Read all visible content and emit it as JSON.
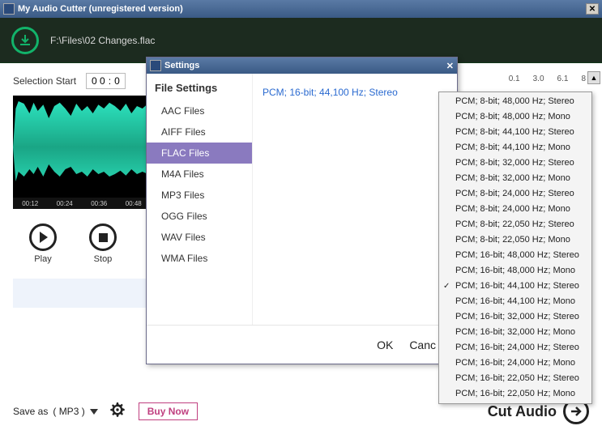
{
  "window": {
    "title": "My Audio Cutter (unregistered version)"
  },
  "file": {
    "path": "F:\\Files\\02 Changes.flac"
  },
  "selection": {
    "start_label": "Selection Start",
    "start_seg1": "0 0",
    "start_seg2": "0"
  },
  "scale": [
    "0.1",
    "3.0",
    "6.1",
    "8"
  ],
  "waveform_ticks": [
    "00:12",
    "00:24",
    "00:36",
    "00:48"
  ],
  "transport": {
    "play": "Play",
    "stop": "Stop"
  },
  "footer": {
    "save_as_prefix": "Save as",
    "save_as_fmt": "( MP3 )",
    "buy": "Buy Now",
    "cut": "Cut Audio"
  },
  "settings": {
    "title": "Settings",
    "heading": "File Settings",
    "items": [
      "AAC Files",
      "AIFF Files",
      "FLAC Files",
      "M4A Files",
      "MP3 Files",
      "OGG Files",
      "WAV Files",
      "WMA Files"
    ],
    "selected_index": 2,
    "current_format": "PCM; 16-bit; 44,100 Hz; Stereo",
    "ok": "OK",
    "cancel": "Canc"
  },
  "dropdown": {
    "options": [
      "PCM; 8-bit; 48,000 Hz; Stereo",
      "PCM; 8-bit; 48,000 Hz; Mono",
      "PCM; 8-bit; 44,100 Hz; Stereo",
      "PCM; 8-bit; 44,100 Hz; Mono",
      "PCM; 8-bit; 32,000 Hz; Stereo",
      "PCM; 8-bit; 32,000 Hz; Mono",
      "PCM; 8-bit; 24,000 Hz; Stereo",
      "PCM; 8-bit; 24,000 Hz; Mono",
      "PCM; 8-bit; 22,050 Hz; Stereo",
      "PCM; 8-bit; 22,050 Hz; Mono",
      "PCM; 16-bit; 48,000 Hz; Stereo",
      "PCM; 16-bit; 48,000 Hz; Mono",
      "PCM; 16-bit; 44,100 Hz; Stereo",
      "PCM; 16-bit; 44,100 Hz; Mono",
      "PCM; 16-bit; 32,000 Hz; Stereo",
      "PCM; 16-bit; 32,000 Hz; Mono",
      "PCM; 16-bit; 24,000 Hz; Stereo",
      "PCM; 16-bit; 24,000 Hz; Mono",
      "PCM; 16-bit; 22,050 Hz; Stereo",
      "PCM; 16-bit; 22,050 Hz; Mono"
    ],
    "checked_index": 12
  }
}
